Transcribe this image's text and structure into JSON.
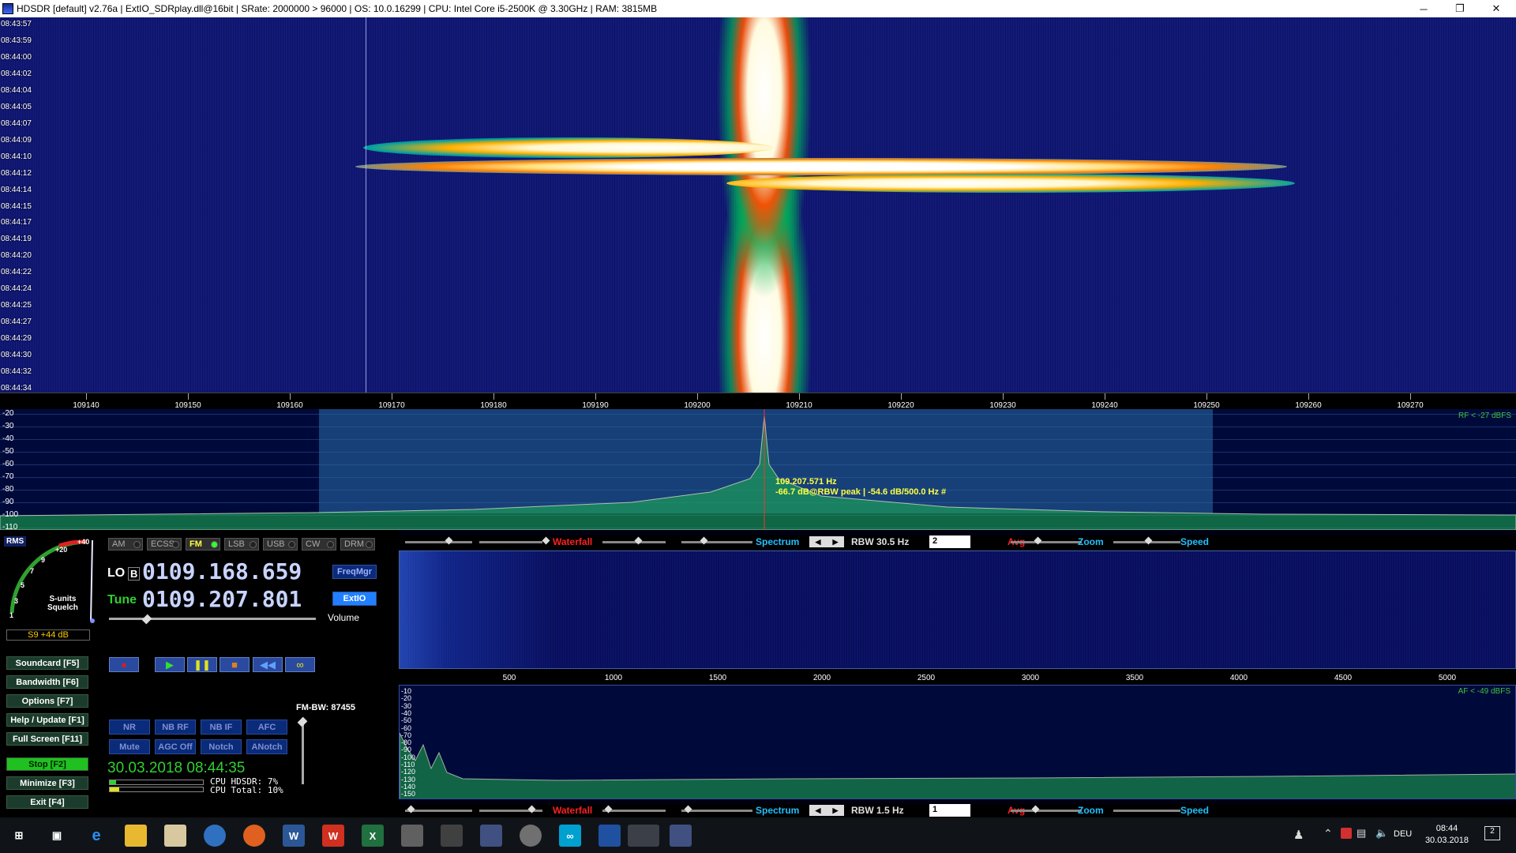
{
  "titlebar": {
    "title": "HDSDR  [default]  v2.76a  |  ExtIO_SDRplay.dll@16bit  |  SRate: 2000000 > 96000  |  OS: 10.0.16299   |  CPU: Intel Core i5-2500K @ 3.30GHz  |  RAM: 3815MB",
    "minimize_icon": "minimize-icon",
    "restore_icon": "restore-icon",
    "close_icon": "close-icon"
  },
  "waterfall": {
    "timestamps": [
      "08:43:57",
      "08:43:59",
      "08:44:00",
      "08:44:02",
      "08:44:04",
      "08:44:05",
      "08:44:07",
      "08:44:09",
      "08:44:10",
      "08:44:12",
      "08:44:14",
      "08:44:15",
      "08:44:17",
      "08:44:19",
      "08:44:20",
      "08:44:22",
      "08:44:24",
      "08:44:25",
      "08:44:27",
      "08:44:29",
      "08:44:30",
      "08:44:32",
      "08:44:34"
    ]
  },
  "freqscale": {
    "ticks": [
      "109140",
      "109150",
      "109160",
      "109170",
      "109180",
      "109190",
      "109200",
      "109210",
      "109220",
      "109230",
      "109240",
      "109250",
      "109260",
      "109270"
    ]
  },
  "spectrum": {
    "db_labels": [
      "-20",
      "-30",
      "-40",
      "-50",
      "-60",
      "-70",
      "-80",
      "-90",
      "-100",
      "-110"
    ],
    "rf_level": "RF < -27 dBFS",
    "peak_freq": "109.207.571 Hz",
    "peak_info": "-66.7 dB@RBW peak | -54.6 dB/500.0 Hz #"
  },
  "smeter": {
    "badge": "RMS",
    "scale": [
      "1",
      "3",
      "5",
      "7",
      "9",
      "+20",
      "+40"
    ],
    "label1": "S-units",
    "label2": "Squelch",
    "value": "S9 +44 dB"
  },
  "modes": [
    {
      "label": "AM",
      "active": false
    },
    {
      "label": "ECSS",
      "active": false
    },
    {
      "label": "FM",
      "active": true
    },
    {
      "label": "LSB",
      "active": false
    },
    {
      "label": "USB",
      "active": false
    },
    {
      "label": "CW",
      "active": false
    },
    {
      "label": "DRM",
      "active": false
    }
  ],
  "radio": {
    "lo_label": "LO",
    "lo_b": "B",
    "lo_freq": "0109.168.659",
    "tune_label": "Tune",
    "tune_freq": "0109.207.801",
    "freqmgr": "FreqMgr",
    "extio": "ExtIO",
    "volume": "Volume",
    "fm_bw": "FM-BW: 87455"
  },
  "sidebuttons": [
    "Soundcard  [F5]",
    "Bandwidth  [F6]",
    "Options  [F7]",
    "Help / Update  [F1]",
    "Full Screen  [F11]",
    "Stop  [F2]",
    "Minimize  [F3]",
    "Exit  [F4]"
  ],
  "dsp": [
    "NR",
    "NB RF",
    "NB IF",
    "AFC",
    "Mute",
    "AGC Off",
    "Notch",
    "ANotch"
  ],
  "status": {
    "datetime": "30.03.2018  08:44:35",
    "cpu_hdsdr": "CPU HDSDR:  7%",
    "cpu_total": "CPU Total: 10%"
  },
  "strip1": {
    "waterfall": "Waterfall",
    "spectrum": "Spectrum",
    "rbw": "RBW  30.5 Hz",
    "avg_value": "2",
    "avg": "Avg",
    "zoom": "Zoom",
    "speed": "Speed"
  },
  "afscale": {
    "ticks": [
      "500",
      "1000",
      "1500",
      "2000",
      "2500",
      "3000",
      "3500",
      "4000",
      "4500",
      "5000"
    ]
  },
  "afspectrum": {
    "db_labels": [
      "-10",
      "-20",
      "-30",
      "-40",
      "-50",
      "-60",
      "-70",
      "-80",
      "-90",
      "-100",
      "-110",
      "-120",
      "-130",
      "-140",
      "-150"
    ],
    "af_level": "AF < -49 dBFS"
  },
  "strip2": {
    "waterfall": "Waterfall",
    "spectrum": "Spectrum",
    "rbw": "RBW  1.5 Hz",
    "avg_value": "1",
    "avg": "Avg",
    "zoom": "Zoom",
    "speed": "Speed"
  },
  "taskbar": {
    "lang": "DEU",
    "time": "08:44",
    "date": "30.03.2018",
    "notification_count": "2"
  }
}
